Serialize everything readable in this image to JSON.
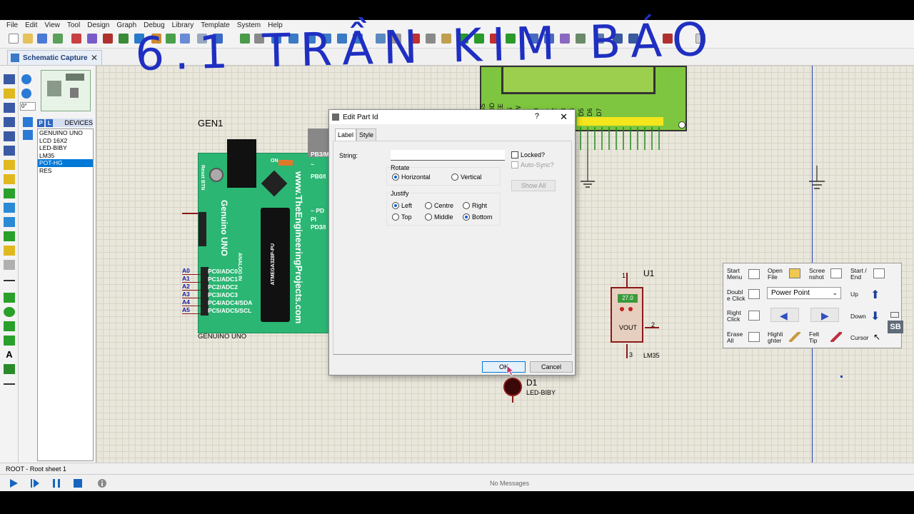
{
  "menu": [
    "File",
    "Edit",
    "View",
    "Tool",
    "Design",
    "Graph",
    "Debug",
    "Library",
    "Template",
    "System",
    "Help"
  ],
  "handwriting": "6.1 TRẦN KIM BẢO",
  "tab": {
    "label": "Schematic Capture",
    "close": "✕"
  },
  "rotation_field": "0°",
  "devices": {
    "header": "DEVICES",
    "p_label": "P",
    "l_label": "L",
    "items": [
      "GENUINO UNO",
      "LCD 16X2",
      "LED-BIBY",
      "LM35",
      "POT-HG",
      "RES"
    ],
    "selected": "POT-HG"
  },
  "schematic": {
    "gen1_label": "GEN1",
    "board_name": "Genuino UNO",
    "board_site": "www.TheEngineeringProjects.com",
    "chip_text": "ATMEGA328P-PU",
    "reset_label": "Reset BTN",
    "on_label": "ON",
    "analog_in": "ANALOG IN",
    "board_caption": "GENUINO UNO",
    "analog_pins": [
      "A0",
      "A1",
      "A2",
      "A3",
      "A4",
      "A5"
    ],
    "analog_functions": [
      "PC0/ADC0",
      "PC1/ADC1",
      "PC2/ADC2",
      "PC3/ADC3",
      "PC4/ADC4/SDA",
      "PC5/ADC5/SCL"
    ],
    "right_pins": [
      "PB3/M",
      "~",
      "PB0/I",
      "~ PD",
      "PI",
      "PD3/I"
    ],
    "lcd_pins": [
      "VSS",
      "VDD",
      "VEE",
      "RS",
      "RW",
      "E",
      "D0",
      "D1",
      "D2",
      "D3",
      "D4",
      "D5",
      "D6",
      "D7"
    ],
    "u1_label": "U1",
    "u1_display": "27.0",
    "u1_vout": "VOUT",
    "u1_pin1": "1",
    "u1_pin2": "2",
    "u1_pin3": "3",
    "u1_part": "LM35",
    "d1_label": "D1",
    "d1_part": "LED-BIBY"
  },
  "dialog": {
    "title": "Edit Part Id",
    "help": "?",
    "close": "✕",
    "tabs": [
      "Label",
      "Style"
    ],
    "string_label": "String:",
    "string_value": "",
    "locked": "Locked?",
    "auto_sync": "Auto-Sync?",
    "show_all": "Show All",
    "rotate_label": "Rotate",
    "horizontal": "Horizontal",
    "vertical": "Vertical",
    "justify_label": "Justify",
    "left": "Left",
    "centre": "Centre",
    "right": "Right",
    "top": "Top",
    "middle": "Middle",
    "bottom": "Bottom",
    "ok": "OK",
    "cancel": "Cancel"
  },
  "tool_panel": {
    "start_menu": "Start Menu",
    "open_file": "Open File",
    "screenshot": "Scree nshot",
    "start_end": "Start / End",
    "double_click": "Doubl e Click",
    "power_point": "Power Point",
    "up": "Up",
    "right_click": "Right Click",
    "down": "Down",
    "erase_all": "Erase All",
    "highlighter": "Highli ghter",
    "felt_tip": "Felt Tip",
    "cursor": "Cursor",
    "sb": "SB"
  },
  "status": {
    "sheet": "ROOT - Root sheet 1",
    "messages": "No Messages"
  },
  "colors": {
    "board": "#2bb673",
    "lcd": "#7ec63f",
    "accent": "#0078d7",
    "handwriting": "#1f2fc2"
  }
}
